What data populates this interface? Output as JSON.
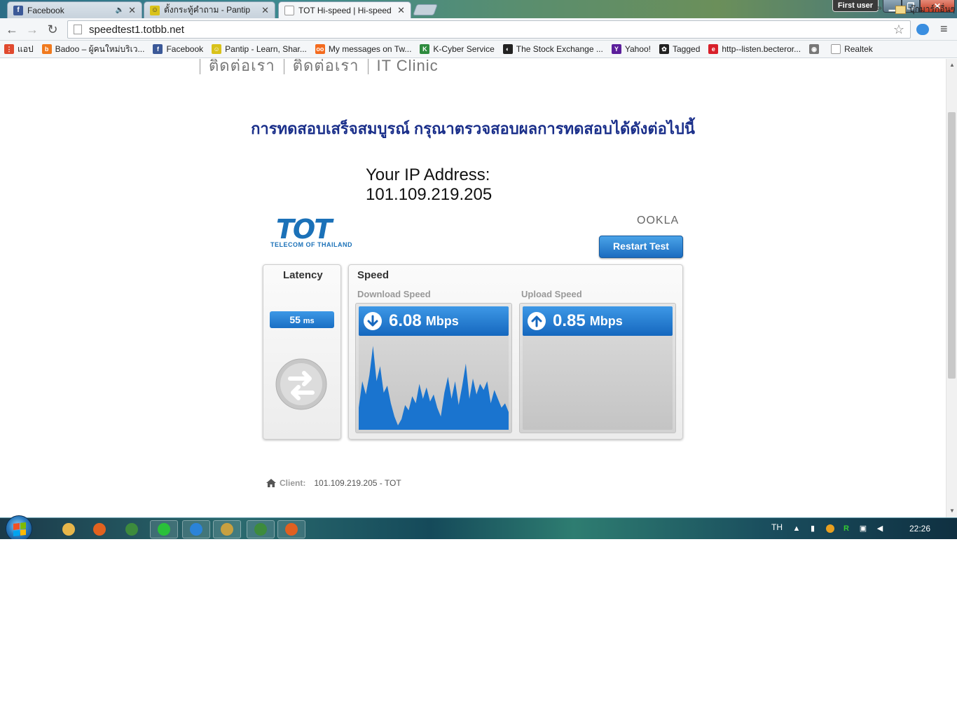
{
  "window": {
    "user_badge": "First user",
    "controls": {
      "min": "▁",
      "max": "❐",
      "close": "✕"
    }
  },
  "tabs": [
    {
      "label": "Facebook",
      "icon": "facebook-icon",
      "color": "#3b5998",
      "glyph": "f",
      "muted": "🔈"
    },
    {
      "label": "ตั้งกระทู้คำถาม - Pantip",
      "icon": "pantip-icon",
      "color": "#d9c21a",
      "glyph": "☺"
    },
    {
      "label": "TOT Hi-speed | Hi-speed I",
      "icon": "page-icon",
      "color": "#ffffff",
      "glyph": ""
    }
  ],
  "toolbar": {
    "back": "←",
    "forward": "→",
    "reload": "↻",
    "url": "speedtest1.totbb.net",
    "star": "☆",
    "menu": "≡"
  },
  "bookmarks": [
    {
      "label": "แอป",
      "icon": "apps-icon",
      "color": "#e04a2f",
      "glyph": "⋮"
    },
    {
      "label": "Badoo – ผู้คนใหม่บริเว...",
      "icon": "badoo-icon",
      "color": "#f07a1e",
      "glyph": "b"
    },
    {
      "label": "Facebook",
      "icon": "facebook-icon",
      "color": "#3b5998",
      "glyph": "f"
    },
    {
      "label": "Pantip - Learn, Shar...",
      "icon": "pantip-icon",
      "color": "#d9c21a",
      "glyph": "☺"
    },
    {
      "label": "My messages on Tw...",
      "icon": "twoo-icon",
      "color": "#f46b1e",
      "glyph": "oo"
    },
    {
      "label": "K-Cyber Service",
      "icon": "kbank-icon",
      "color": "#2e8b3e",
      "glyph": "K"
    },
    {
      "label": "The Stock Exchange ...",
      "icon": "set-icon",
      "color": "#222222",
      "glyph": "◐"
    },
    {
      "label": "Yahoo!",
      "icon": "yahoo-icon",
      "color": "#5c1f9b",
      "glyph": "Y"
    },
    {
      "label": "Tagged",
      "icon": "tagged-icon",
      "color": "#222222",
      "glyph": "✿"
    },
    {
      "label": "http--listen.becteror...",
      "icon": "becteror-icon",
      "color": "#d8202a",
      "glyph": "e"
    },
    {
      "label": "",
      "icon": "owl-icon",
      "color": "#777777",
      "glyph": "◉"
    },
    {
      "label": "Realtek",
      "icon": "page-icon",
      "color": "#ffffff",
      "glyph": ""
    }
  ],
  "bookmarks_more": "»",
  "bookmarks_folder": "บุ๊กมาร์กอื่นๆ",
  "page": {
    "topnav": [
      "ติดต่อเรา",
      "ติดต่อเรา",
      "IT Clinic"
    ],
    "headline": "การทดสอบเสร็จสมบูรณ์ กรุณาตรวจสอบผลการทดสอบได้ดังต่อไปนี้",
    "ip_label": "Your IP Address:",
    "ip_value": "101.109.219.205",
    "logo": {
      "letters": "TOT",
      "sub": "TELECOM OF THAILAND"
    },
    "ookla": "OOKLA",
    "restart_button": "Restart Test",
    "latency": {
      "title": "Latency",
      "value": "55",
      "unit": "ms"
    },
    "speed": {
      "title": "Speed",
      "download": {
        "label": "Download Speed",
        "value": "6.08",
        "unit": "Mbps"
      },
      "upload": {
        "label": "Upload Speed",
        "value": "0.85",
        "unit": "Mbps"
      }
    },
    "client": {
      "label": "Client:",
      "value": "101.109.219.205 - TOT"
    }
  },
  "download_graph": [
    0.25,
    0.55,
    0.4,
    0.62,
    0.95,
    0.55,
    0.72,
    0.42,
    0.5,
    0.3,
    0.15,
    0.05,
    0.12,
    0.28,
    0.22,
    0.38,
    0.3,
    0.52,
    0.35,
    0.48,
    0.32,
    0.4,
    0.25,
    0.15,
    0.42,
    0.6,
    0.35,
    0.55,
    0.28,
    0.5,
    0.75,
    0.35,
    0.58,
    0.4,
    0.52,
    0.45,
    0.55,
    0.3,
    0.45,
    0.35,
    0.25,
    0.3,
    0.2
  ],
  "taskbar": {
    "lang": "TH",
    "clock": "22:26",
    "apps": [
      {
        "icon": "explorer-icon",
        "color": "#e8b64a"
      },
      {
        "icon": "firefox-icon",
        "color": "#e2621f"
      },
      {
        "icon": "chrome-icon",
        "color": "#3d8b3d"
      },
      {
        "icon": "line-icon",
        "color": "#2ac03a"
      },
      {
        "icon": "ie-icon",
        "color": "#2b83d8"
      },
      {
        "icon": "app-icon",
        "color": "#c8a040"
      },
      {
        "icon": "chrome-icon",
        "color": "#3d8b3d"
      },
      {
        "icon": "app-icon",
        "color": "#e06020"
      }
    ]
  }
}
